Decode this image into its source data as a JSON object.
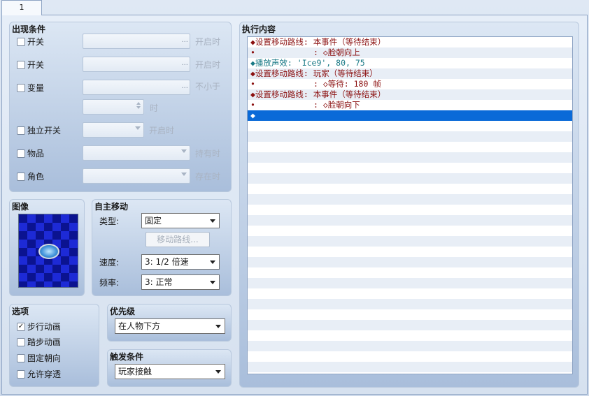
{
  "tab": {
    "label": "1"
  },
  "conditions": {
    "title": "出现条件",
    "switch1": {
      "label": "开关",
      "suffix": "开启时",
      "checked": false
    },
    "switch2": {
      "label": "开关",
      "suffix": "开启时",
      "checked": false
    },
    "variable": {
      "label": "变量",
      "suffix": "不小于",
      "checked": false
    },
    "variable_unit": "时",
    "self_switch": {
      "label": "独立开关",
      "suffix": "开启时",
      "checked": false
    },
    "item": {
      "label": "物品",
      "suffix": "持有时",
      "checked": false
    },
    "actor": {
      "label": "角色",
      "suffix": "存在时",
      "checked": false
    },
    "ellipsis": "..."
  },
  "image": {
    "title": "图像"
  },
  "autonomous": {
    "title": "自主移动",
    "type_label": "类型:",
    "type_value": "固定",
    "route_button": "移动路线...",
    "speed_label": "速度:",
    "speed_value": "3: 1/2 倍速",
    "freq_label": "频率:",
    "freq_value": "3: 正常"
  },
  "options": {
    "title": "选项",
    "walk": {
      "label": "步行动画",
      "checked": true
    },
    "step": {
      "label": "踏步动画",
      "checked": false
    },
    "dirfix": {
      "label": "固定朝向",
      "checked": false
    },
    "through": {
      "label": "允许穿透",
      "checked": false
    }
  },
  "priority": {
    "title": "优先级",
    "value": "在人物下方"
  },
  "trigger": {
    "title": "触发条件",
    "value": "玩家接触"
  },
  "contents": {
    "title": "执行内容",
    "lines": [
      {
        "text": "◆设置移动路线: 本事件（等待结束）",
        "color": "red"
      },
      {
        "text": "•            : ◇脸朝向上",
        "color": "red"
      },
      {
        "text": "◆播放声效: 'Ice9', 80, 75",
        "color": "teal"
      },
      {
        "text": "◆设置移动路线: 玩家（等待结束）",
        "color": "red"
      },
      {
        "text": "•            : ◇等待: 180 帧",
        "color": "red"
      },
      {
        "text": "◆设置移动路线: 本事件（等待结束）",
        "color": "red"
      },
      {
        "text": "•            : ◇脸朝向下",
        "color": "red"
      },
      {
        "text": "◆",
        "color": "sel"
      }
    ]
  }
}
